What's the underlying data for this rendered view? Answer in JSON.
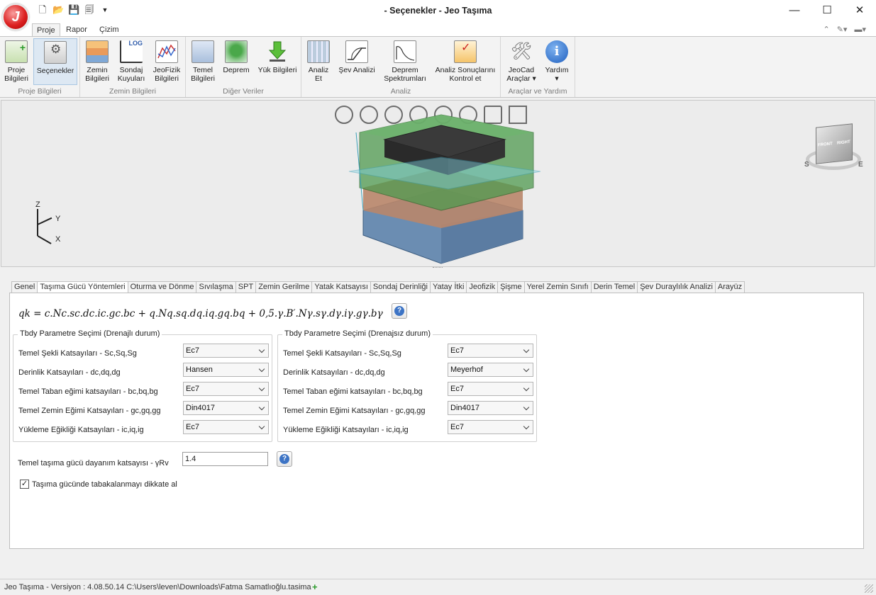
{
  "app": {
    "title": "- Seçenekler - Jeo Taşıma",
    "logo_letter": "J"
  },
  "qat": {
    "icons": [
      "new-file-icon",
      "open-folder-icon",
      "save-icon",
      "save-all-icon",
      "customize-arrow-icon"
    ]
  },
  "window_buttons": {
    "minimize": "—",
    "maximize": "☐",
    "close": "✕"
  },
  "ribbon_tabs": [
    "Proje",
    "Rapor",
    "Çizim"
  ],
  "ribbon_groups": [
    {
      "label": "Proje Bilgileri"
    },
    {
      "label": "Zemin Bilgileri"
    },
    {
      "label": "Diğer Veriler"
    },
    {
      "label": "Analiz"
    },
    {
      "label": "Araçlar ve Yardım"
    }
  ],
  "ribbon_buttons": {
    "proje_bilgileri": [
      "Proje",
      "Bilgileri"
    ],
    "secenekler": "Seçenekler",
    "zemin_bilgileri": [
      "Zemin",
      "Bilgileri"
    ],
    "sondaj_kuyulari": [
      "Sondaj",
      "Kuyuları"
    ],
    "jeofizik_bilgileri": [
      "JeoFizik",
      "Bilgileri"
    ],
    "temel_bilgileri": [
      "Temel",
      "Bilgileri"
    ],
    "deprem": "Deprem",
    "yuk_bilgileri": "Yük Bilgileri",
    "analiz_et": [
      "Analiz",
      "Et"
    ],
    "sev_analizi": "Şev Analizi",
    "deprem_spektrumlari": [
      "Deprem",
      "Spektrumları"
    ],
    "analiz_kontrol": [
      "Analiz Sonuçlarını",
      "Kontrol et"
    ],
    "jeocad": [
      "JeoCad",
      "Araçlar ▾"
    ],
    "yardim": [
      "Yardım",
      "▾"
    ],
    "log_badge": "LOG"
  },
  "viewport": {
    "axes": {
      "z": "Z",
      "y": "Y",
      "x": "X"
    },
    "view_cube": {
      "front": "FRONT",
      "right": "RIGHT",
      "s": "S",
      "e": "E"
    }
  },
  "option_tabs": [
    "Genel",
    "Taşıma Gücü Yöntemleri",
    "Oturma ve Dönme",
    "Sıvılaşma",
    "SPT",
    "Zemin Gerilme",
    "Yatak Katsayısı",
    "Sondaj Derinliği",
    "Yatay İtki",
    "Jeofizik",
    "Şişme",
    "Yerel Zemin Sınıfı",
    "Derin Temel",
    "Şev Duraylılık Analizi",
    "Arayüz"
  ],
  "active_option_tab": "Taşıma Gücü Yöntemleri",
  "formula": "qk = c.Nc.sc.dc.ic.gc.bc + q.Nq.sq.dq.iq.gq.bq + 0,5.γ.B′.Nγ.sγ.dγ.iγ.gγ.bγ",
  "drained": {
    "title": "Tbdy Parametre Seçimi (Drenajlı durum)",
    "rows": [
      {
        "label": "Temel Şekli Katsayıları - Sc,Sq,Sg",
        "value": "Ec7"
      },
      {
        "label": "Derinlik Katsayıları - dc,dq,dg",
        "value": "Hansen"
      },
      {
        "label": "Temel Taban eğimi katsayıları - bc,bq,bg",
        "value": "Ec7"
      },
      {
        "label": "Temel Zemin Eğimi Katsayıları - gc,gq,gg",
        "value": "Din4017"
      },
      {
        "label": "Yükleme Eğikliği Katsayıları - ic,iq,ig",
        "value": "Ec7"
      }
    ]
  },
  "undrained": {
    "title": "Tbdy Parametre Seçimi  (Drenajsız durum)",
    "rows": [
      {
        "label": "Temel Şekli Katsayıları - Sc,Sq,Sg",
        "value": "Ec7"
      },
      {
        "label": "Derinlik Katsayıları - dc,dq,dg",
        "value": "Meyerhof"
      },
      {
        "label": "Temel Taban eğimi katsayıları - bc,bq,bg",
        "value": "Ec7"
      },
      {
        "label": "Temel Zemin Eğimi Katsayıları - gc,gq,gg",
        "value": "Din4017"
      },
      {
        "label": "Yükleme Eğikliği Katsayıları - ic,iq,ig",
        "value": "Ec7"
      }
    ]
  },
  "resistance": {
    "label": "Temel taşıma gücü dayanım katsayısı - γRv",
    "value": "1.4"
  },
  "layering": {
    "label": "Taşıma gücünde tabakalanmayı dikkate al",
    "checked": true
  },
  "status": {
    "text": "Jeo Taşıma - Versiyon : 4.08.50.14  C:\\Users\\leven\\Downloads\\Fatma Samatlıoğlu.tasima",
    "plus": "+"
  }
}
